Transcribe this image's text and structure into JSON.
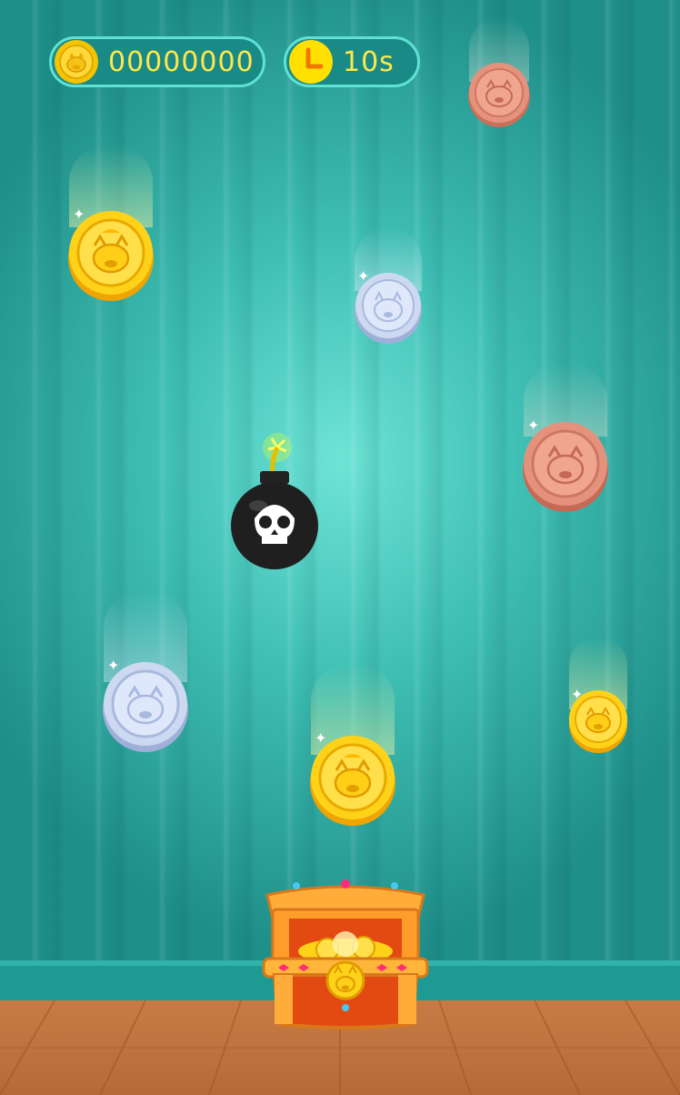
{
  "hud": {
    "score": "00000000",
    "timer": "10s",
    "score_icon": "pig-coin-icon",
    "timer_icon": "clock-icon"
  },
  "colors": {
    "gold": "#f5c400",
    "silver": "#c9d6ee",
    "bronze": "#e49680",
    "accent": "#ffe84a",
    "hud_bg": "#1a8a86"
  },
  "objects": [
    {
      "kind": "coin",
      "metal": "bronze"
    },
    {
      "kind": "coin",
      "metal": "gold"
    },
    {
      "kind": "coin",
      "metal": "silver"
    },
    {
      "kind": "coin",
      "metal": "bronze"
    },
    {
      "kind": "bomb"
    },
    {
      "kind": "coin",
      "metal": "silver"
    },
    {
      "kind": "coin",
      "metal": "gold"
    },
    {
      "kind": "coin",
      "metal": "gold"
    },
    {
      "kind": "treasure-chest"
    }
  ]
}
